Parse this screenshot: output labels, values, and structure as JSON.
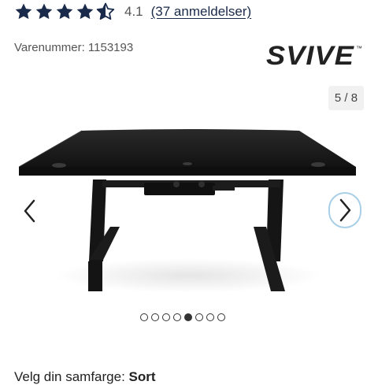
{
  "rating": {
    "score": "4.1",
    "stars_filled": 4.5,
    "stars_total": 5,
    "reviews_link": "(37 anmeldelser)",
    "star_color": "#1a2a4a"
  },
  "product": {
    "sku_label": "Varenummer: 1153193",
    "brand": "SVIVE",
    "brand_mark": "™"
  },
  "gallery": {
    "counter": "5 / 8",
    "current_index": 5,
    "total": 8,
    "prev_icon": "chevron-left-icon",
    "next_icon": "chevron-right-icon"
  },
  "color_select": {
    "label": "Velg din samfarge:",
    "value": "Sort"
  },
  "colors": {
    "accent_focus": "#a8cfe8",
    "text": "#222222",
    "muted": "#555555"
  }
}
